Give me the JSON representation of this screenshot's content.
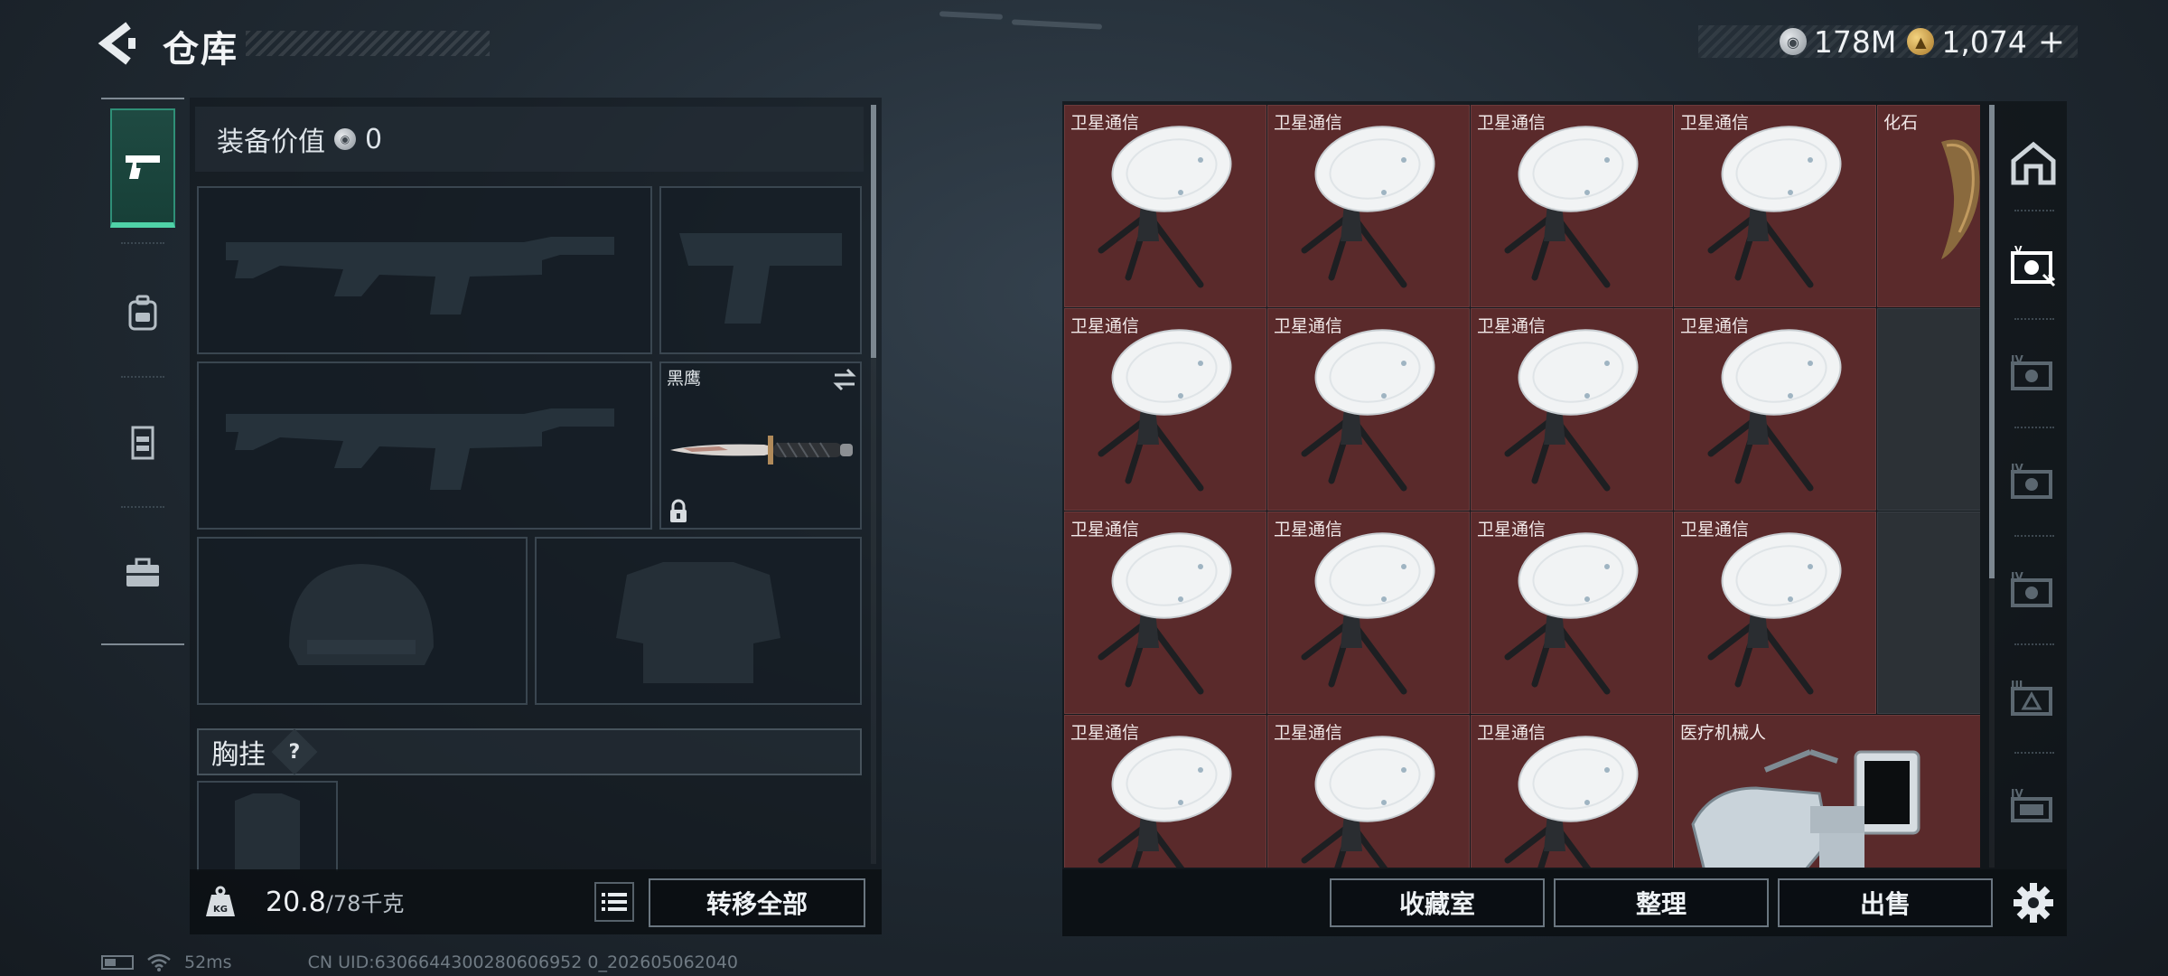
{
  "header": {
    "title": "仓库",
    "currencies": [
      {
        "icon": "silver-coin-icon",
        "value": "178M"
      },
      {
        "icon": "gold-coin-icon",
        "value": "1,074"
      }
    ],
    "add_label": "+"
  },
  "left_nav": {
    "items": [
      {
        "name": "weapons",
        "icon": "pistol-icon",
        "active": true
      },
      {
        "name": "backpack",
        "icon": "backpack-icon",
        "active": false
      },
      {
        "name": "armor",
        "icon": "vest-icon",
        "active": false
      },
      {
        "name": "toolkit",
        "icon": "toolbox-icon",
        "active": false
      }
    ]
  },
  "loadout": {
    "equip_value_label": "装备价值",
    "equip_value": "0",
    "melee_name": "黑鹰",
    "chest_label": "胸挂",
    "chest_help": "?",
    "weight_current": "20.8",
    "weight_max": "/78千克",
    "transfer_all_label": "转移全部"
  },
  "storage": {
    "items": [
      {
        "label": "卫星通信",
        "type": "dish"
      },
      {
        "label": "卫星通信",
        "type": "dish"
      },
      {
        "label": "卫星通信",
        "type": "dish"
      },
      {
        "label": "卫星通信",
        "type": "dish"
      },
      {
        "label": "化石",
        "type": "fossil"
      },
      {
        "label": "卫星通信",
        "type": "dish"
      },
      {
        "label": "卫星通信",
        "type": "dish"
      },
      {
        "label": "卫星通信",
        "type": "dish"
      },
      {
        "label": "卫星通信",
        "type": "dish"
      },
      {
        "label": "",
        "type": "empty"
      },
      {
        "label": "卫星通信",
        "type": "dish"
      },
      {
        "label": "卫星通信",
        "type": "dish"
      },
      {
        "label": "卫星通信",
        "type": "dish"
      },
      {
        "label": "卫星通信",
        "type": "dish"
      },
      {
        "label": "",
        "type": "empty"
      },
      {
        "label": "卫星通信",
        "type": "dish"
      },
      {
        "label": "卫星通信",
        "type": "dish"
      },
      {
        "label": "卫星通信",
        "type": "dish"
      },
      {
        "label": "医疗机械人",
        "type": "robot"
      }
    ],
    "buttons": {
      "collection": "收藏室",
      "sort": "整理",
      "sell": "出售"
    },
    "side_tabs": [
      "home-icon",
      "case-icon",
      "case-iv-icon",
      "case-iv-icon",
      "case-iv-icon",
      "case-iii-icon",
      "case-iv-icon"
    ]
  },
  "status": {
    "ping": "52ms",
    "uid": "CN UID:6306644300280606952 0_202605062040"
  }
}
